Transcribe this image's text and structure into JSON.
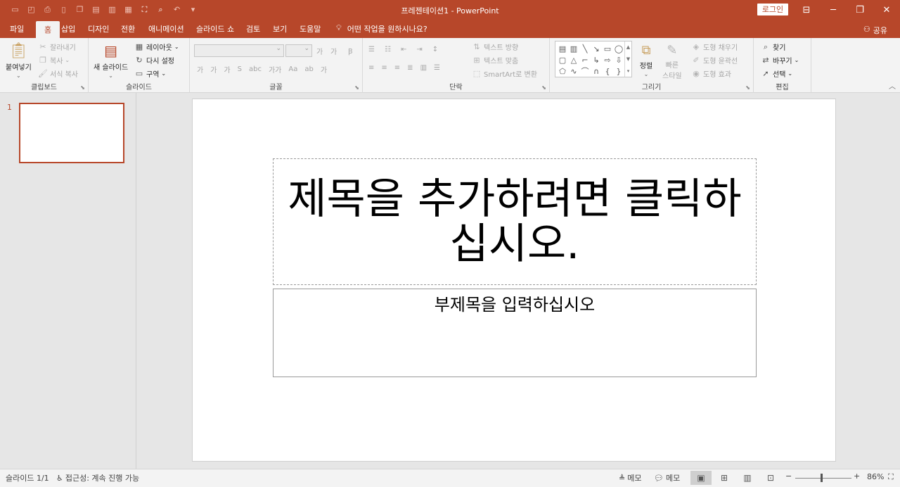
{
  "window": {
    "title": "프레젠테이션1  -  PowerPoint",
    "login": "로그인"
  },
  "menu": {
    "tabs": [
      "파일",
      "홈",
      "삽입",
      "디자인",
      "전환",
      "애니메이션",
      "슬라이드 쇼",
      "검토",
      "보기",
      "도움말"
    ],
    "tellme": "어떤 작업을 원하시나요?",
    "share": "공유"
  },
  "ribbon": {
    "clipboard": {
      "paste": "붙여넣기",
      "cut": "잘라내기",
      "copy": "복사",
      "format_painter": "서식 복사",
      "label": "클립보드"
    },
    "slides": {
      "new_slide": "새 슬라이드",
      "layout": "레이아웃",
      "reset": "다시 설정",
      "section": "구역",
      "label": "슬라이드"
    },
    "font": {
      "label": "글꼴"
    },
    "paragraph": {
      "text_direction": "텍스트 방향",
      "align_text": "텍스트 맞춤",
      "smartart": "SmartArt로 변환",
      "label": "단락"
    },
    "drawing": {
      "arrange": "정렬",
      "quick_styles_1": "빠른",
      "quick_styles_2": "스타일",
      "shape_fill": "도형 채우기",
      "shape_outline": "도형 윤곽선",
      "shape_effects": "도형 효과",
      "label": "그리기"
    },
    "editing": {
      "find": "찾기",
      "replace": "바꾸기",
      "select": "선택",
      "label": "편집"
    }
  },
  "slides_pane": {
    "number": "1"
  },
  "slide": {
    "title_placeholder": "제목을 추가하려면 클릭하십시오.",
    "subtitle_placeholder": "부제목을 입력하십시오"
  },
  "status": {
    "slide_counter": "슬라이드 1/1",
    "accessibility": "접근성: 계속 진행 가능",
    "notes": "메모",
    "comments": "메모",
    "zoom": "86%",
    "zoom_level": 0.46
  },
  "colors": {
    "accent": "#b7472a"
  }
}
